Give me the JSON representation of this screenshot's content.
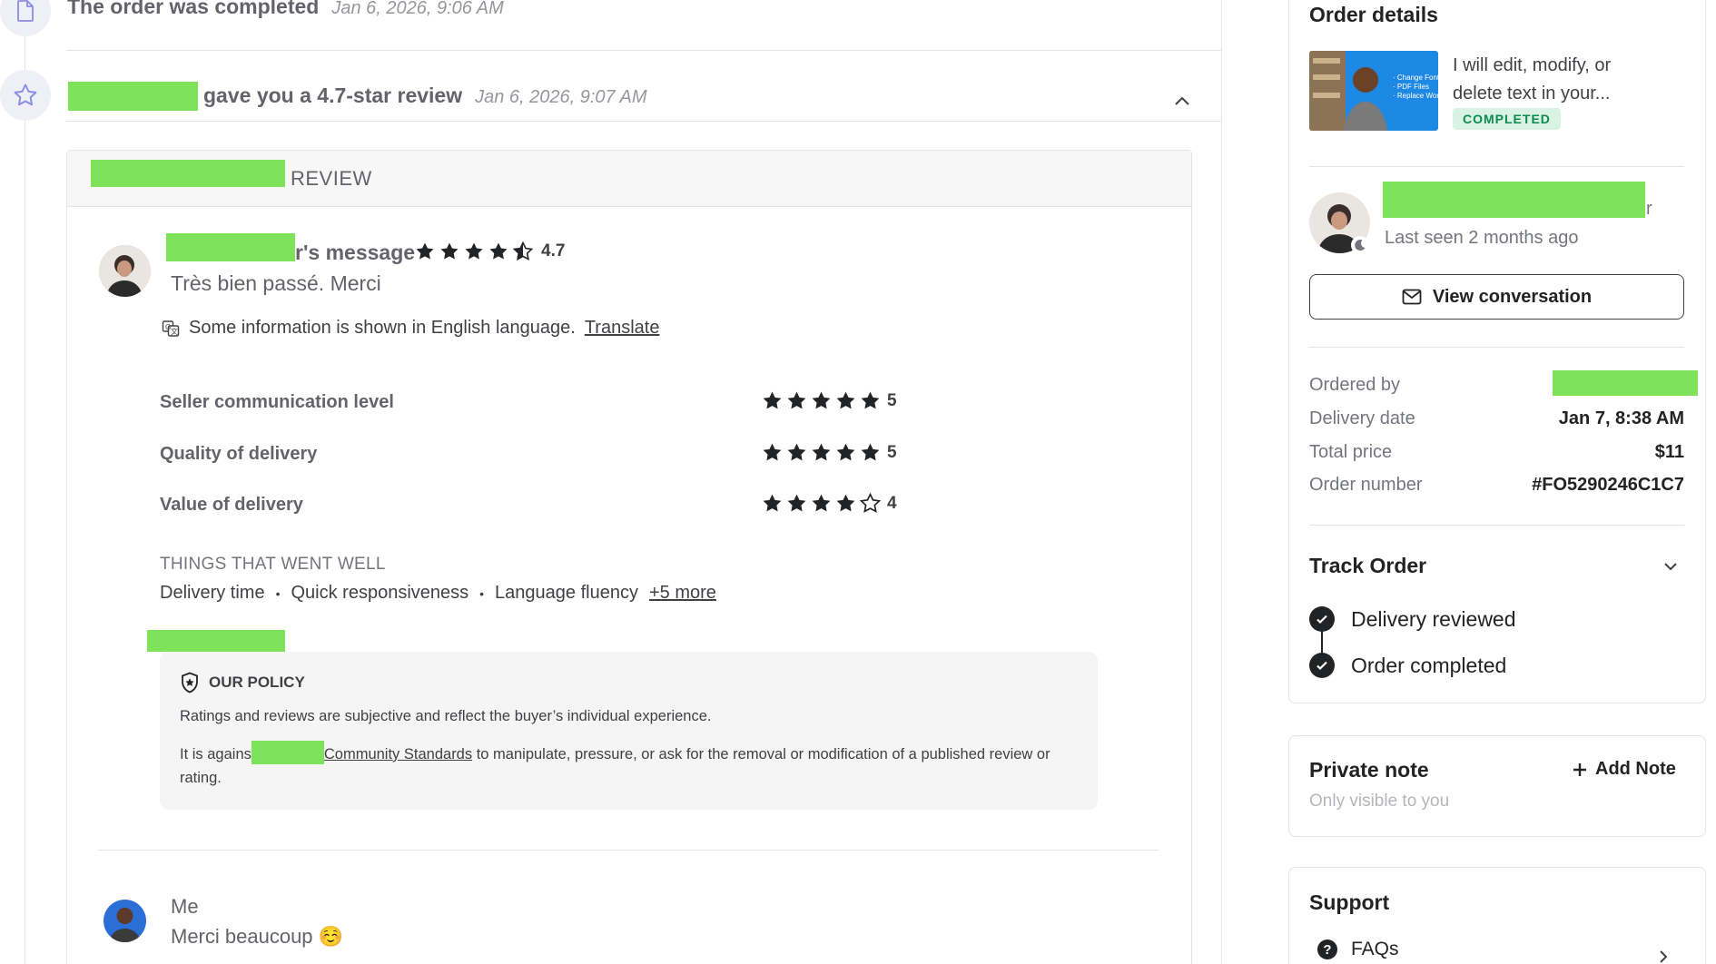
{
  "timeline": {
    "completed": {
      "title": "The order was completed",
      "date": "Jan 6, 2026, 9:06 AM",
      "icon": "document-icon"
    },
    "review": {
      "title": "gave you a 4.7-star review",
      "date": "Jan 6, 2026, 9:07 AM",
      "icon": "star-icon",
      "toggle_icon": "chevron-up-icon"
    }
  },
  "review_card": {
    "header_label": "REVIEW",
    "buyer_message": {
      "title_suffix": "r's message",
      "rating_value": "4.7",
      "stars_full": 4,
      "stars_half": 1,
      "text": "Très bien passé. Merci"
    },
    "translation_note": {
      "text": "Some information is shown in English language.",
      "link": "Translate"
    },
    "ratings": [
      {
        "label": "Seller communication level",
        "value": "5",
        "stars": 5
      },
      {
        "label": "Quality of delivery",
        "value": "5",
        "stars": 5
      },
      {
        "label": "Value of delivery",
        "value": "4",
        "stars": 4
      }
    ],
    "went_well": {
      "heading": "THINGS THAT WENT WELL",
      "items": [
        "Delivery time",
        "Quick responsiveness",
        "Language fluency"
      ],
      "more": "+5 more"
    },
    "policy": {
      "heading": "OUR POLICY",
      "p1": "Ratings and reviews are subjective and reflect the buyer’s individual experience.",
      "p2_start": "It is agains",
      "p2_link": "Community Standards",
      "p2_end": " to manipulate, pressure, or ask for the removal or modification of a published review or rating."
    },
    "reply": {
      "author": "Me",
      "text": "Merci beaucoup ☺️"
    }
  },
  "sidebar": {
    "order_details": {
      "title": "Order details",
      "gig_title": "I will edit, modify, or delete text in your...",
      "status": "COMPLETED"
    },
    "buyer": {
      "name_suffix": "r",
      "last_seen": "Last seen 2 months ago",
      "button": "View conversation"
    },
    "details": [
      {
        "label": "Ordered by",
        "value": ""
      },
      {
        "label": "Delivery date",
        "value": "Jan 7, 8:38 AM"
      },
      {
        "label": "Total price",
        "value": "$11"
      },
      {
        "label": "Order number",
        "value": "#FO5290246C1C7"
      }
    ],
    "track": {
      "title": "Track Order",
      "steps": [
        "Delivery reviewed",
        "Order completed"
      ]
    },
    "private_note": {
      "title": "Private note",
      "subtitle": "Only visible to you",
      "add": "Add Note"
    },
    "support": {
      "title": "Support",
      "faq": "FAQs"
    },
    "colors": {
      "accent_green": "#1dbf73",
      "redaction": "#7ee35a",
      "text_dark": "#222325"
    }
  }
}
